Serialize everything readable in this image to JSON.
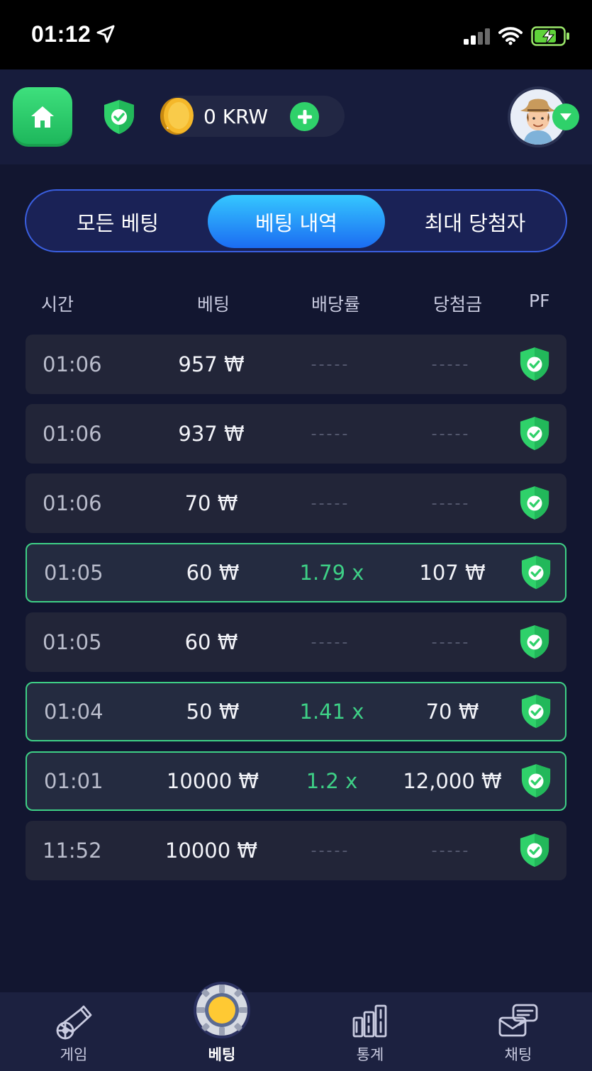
{
  "status_bar": {
    "time": "01:12"
  },
  "header": {
    "balance": "0 KRW"
  },
  "tabs": [
    {
      "label": "모든 베팅",
      "active": false
    },
    {
      "label": "베팅 내역",
      "active": true
    },
    {
      "label": "최대 당첨자",
      "active": false
    }
  ],
  "columns": {
    "time": "시간",
    "bet": "베팅",
    "odds": "배당률",
    "payout": "당첨금",
    "pf": "PF"
  },
  "rows": [
    {
      "time": "01:06",
      "bet": "957 ₩",
      "odds": "-----",
      "payout": "-----",
      "win": false
    },
    {
      "time": "01:06",
      "bet": "937 ₩",
      "odds": "-----",
      "payout": "-----",
      "win": false
    },
    {
      "time": "01:06",
      "bet": "70 ₩",
      "odds": "-----",
      "payout": "-----",
      "win": false
    },
    {
      "time": "01:05",
      "bet": "60 ₩",
      "odds": "1.79 x",
      "payout": "107 ₩",
      "win": true
    },
    {
      "time": "01:05",
      "bet": "60 ₩",
      "odds": "-----",
      "payout": "-----",
      "win": false
    },
    {
      "time": "01:04",
      "bet": "50 ₩",
      "odds": "1.41 x",
      "payout": "70 ₩",
      "win": true
    },
    {
      "time": "01:01",
      "bet": "10000 ₩",
      "odds": "1.2 x",
      "payout": "12,000 ₩",
      "win": true
    },
    {
      "time": "11:52",
      "bet": "10000 ₩",
      "odds": "-----",
      "payout": "-----",
      "win": false
    }
  ],
  "bottom_nav": [
    {
      "label": "게임",
      "icon": "cannon-icon",
      "active": false
    },
    {
      "label": "베팅",
      "icon": "casino-chip-icon",
      "active": true
    },
    {
      "label": "통계",
      "icon": "bar-chart-icon",
      "active": false
    },
    {
      "label": "채팅",
      "icon": "chat-icon",
      "active": false
    }
  ],
  "colors": {
    "background": "#121630",
    "accent_green": "#3ed086",
    "tab_active": "#1b6cf2",
    "row_bg": "#222538"
  }
}
